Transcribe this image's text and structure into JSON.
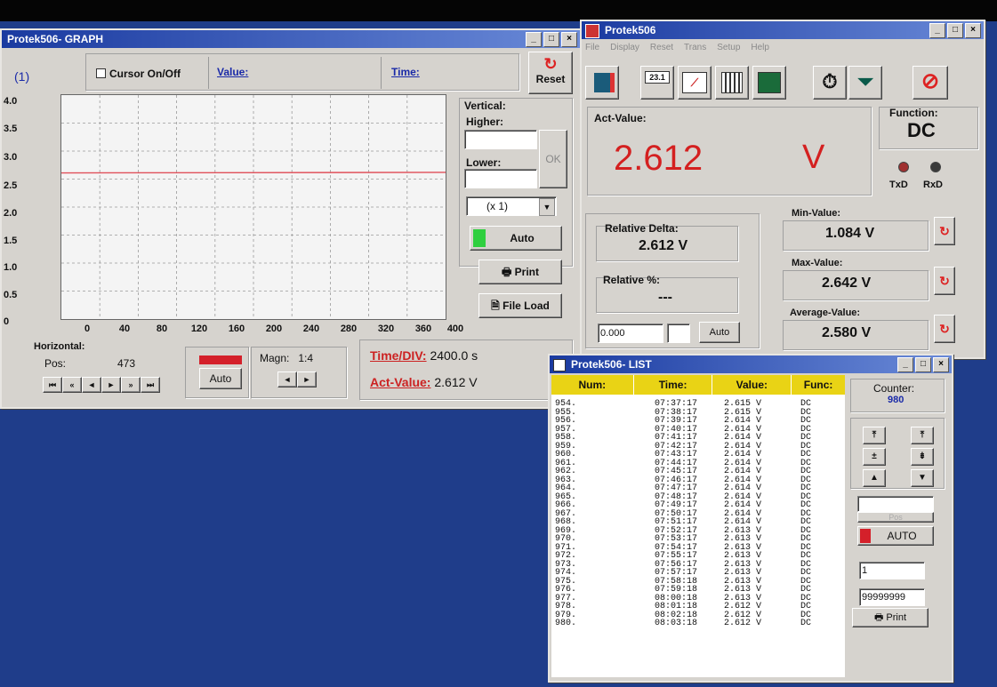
{
  "graph": {
    "title": "Protek506- GRAPH",
    "channel": "(1)",
    "cursor_label": "Cursor On/Off",
    "value_label": "Value:",
    "time_label": "Time:",
    "reset_label": "Reset",
    "vertical_label": "Vertical:",
    "higher_label": "Higher:",
    "lower_label": "Lower:",
    "ok_label": "OK",
    "scale_select": "(x 1)",
    "auto_label": "Auto",
    "print_label": "Print",
    "file_load_label": "File Load",
    "horizontal_label": "Horizontal:",
    "pos_label": "Pos:",
    "pos_value": "473",
    "h_auto_label": "Auto",
    "magn_label": "Magn:",
    "magn_value": "1:4",
    "time_div_label": "Time/DIV:",
    "time_div_value": "2400.0 s",
    "act_value_label": "Act-Value:",
    "act_value_value": "2.612 V",
    "nav_buttons": [
      "⏮",
      "«",
      "◄",
      "►",
      "»",
      "⏭"
    ],
    "magn_buttons": [
      "◄",
      "►"
    ]
  },
  "chart_data": {
    "type": "line",
    "y_ticks": [
      "4.0",
      "3.5",
      "3.0",
      "2.5",
      "2.0",
      "1.5",
      "1.0",
      "0.5",
      "0"
    ],
    "x_ticks": [
      "0",
      "40",
      "80",
      "120",
      "160",
      "200",
      "240",
      "280",
      "320",
      "360",
      "400"
    ],
    "xlim": [
      0,
      400
    ],
    "ylim": [
      0,
      4.0
    ],
    "grid": true,
    "series": [
      {
        "x": [
          0,
          400
        ],
        "y": [
          2.61,
          2.62
        ],
        "color": "#e0505a"
      }
    ]
  },
  "main": {
    "title": "Protek506",
    "menu": [
      "File",
      "Display",
      "Reset",
      "Trans",
      "Setup",
      "Help"
    ],
    "act_value_label": "Act-Value:",
    "act_value": "2.612",
    "act_unit": "V",
    "function_label": "Function:",
    "function_value": "DC",
    "txd_label": "TxD",
    "rxd_label": "RxD",
    "relative_delta_label": "Relative Delta:",
    "relative_delta_value": "2.612 V",
    "relative_pct_label": "Relative %:",
    "relative_pct_value": "---",
    "offset_value": "0.000",
    "auto_label": "Auto",
    "min_label": "Min-Value:",
    "min_value": "1.084 V",
    "max_label": "Max-Value:",
    "max_value": "2.642 V",
    "avg_label": "Average-Value:",
    "avg_value": "2.580 V",
    "toolbar_display_text": "23.1"
  },
  "list": {
    "title": "Protek506- LIST",
    "headers": [
      "Num:",
      "Time:",
      "Value:",
      "Func:"
    ],
    "rows": [
      [
        "954.",
        "07:37:17",
        "2.615 V",
        "DC"
      ],
      [
        "955.",
        "07:38:17",
        "2.615 V",
        "DC"
      ],
      [
        "956.",
        "07:39:17",
        "2.614 V",
        "DC"
      ],
      [
        "957.",
        "07:40:17",
        "2.614 V",
        "DC"
      ],
      [
        "958.",
        "07:41:17",
        "2.614 V",
        "DC"
      ],
      [
        "959.",
        "07:42:17",
        "2.614 V",
        "DC"
      ],
      [
        "960.",
        "07:43:17",
        "2.614 V",
        "DC"
      ],
      [
        "961.",
        "07:44:17",
        "2.614 V",
        "DC"
      ],
      [
        "962.",
        "07:45:17",
        "2.614 V",
        "DC"
      ],
      [
        "963.",
        "07:46:17",
        "2.614 V",
        "DC"
      ],
      [
        "964.",
        "07:47:17",
        "2.614 V",
        "DC"
      ],
      [
        "965.",
        "07:48:17",
        "2.614 V",
        "DC"
      ],
      [
        "966.",
        "07:49:17",
        "2.614 V",
        "DC"
      ],
      [
        "967.",
        "07:50:17",
        "2.614 V",
        "DC"
      ],
      [
        "968.",
        "07:51:17",
        "2.614 V",
        "DC"
      ],
      [
        "969.",
        "07:52:17",
        "2.613 V",
        "DC"
      ],
      [
        "970.",
        "07:53:17",
        "2.613 V",
        "DC"
      ],
      [
        "971.",
        "07:54:17",
        "2.613 V",
        "DC"
      ],
      [
        "972.",
        "07:55:17",
        "2.613 V",
        "DC"
      ],
      [
        "973.",
        "07:56:17",
        "2.613 V",
        "DC"
      ],
      [
        "974.",
        "07:57:17",
        "2.613 V",
        "DC"
      ],
      [
        "975.",
        "07:58:18",
        "2.613 V",
        "DC"
      ],
      [
        "976.",
        "07:59:18",
        "2.613 V",
        "DC"
      ],
      [
        "977.",
        "08:00:18",
        "2.613 V",
        "DC"
      ],
      [
        "978.",
        "08:01:18",
        "2.612 V",
        "DC"
      ],
      [
        "979.",
        "08:02:18",
        "2.612 V",
        "DC"
      ],
      [
        "980.",
        "08:03:18",
        "2.612 V",
        "DC"
      ]
    ],
    "counter_label": "Counter:",
    "counter_value": "980",
    "nav_buttons": [
      "⤒",
      "⤒",
      "±",
      "⇟",
      "▲",
      "▼"
    ],
    "pos_label": "Pos",
    "auto_label": "AUTO",
    "from_value": "1",
    "to_value": "99999999",
    "print_label": "Print"
  }
}
